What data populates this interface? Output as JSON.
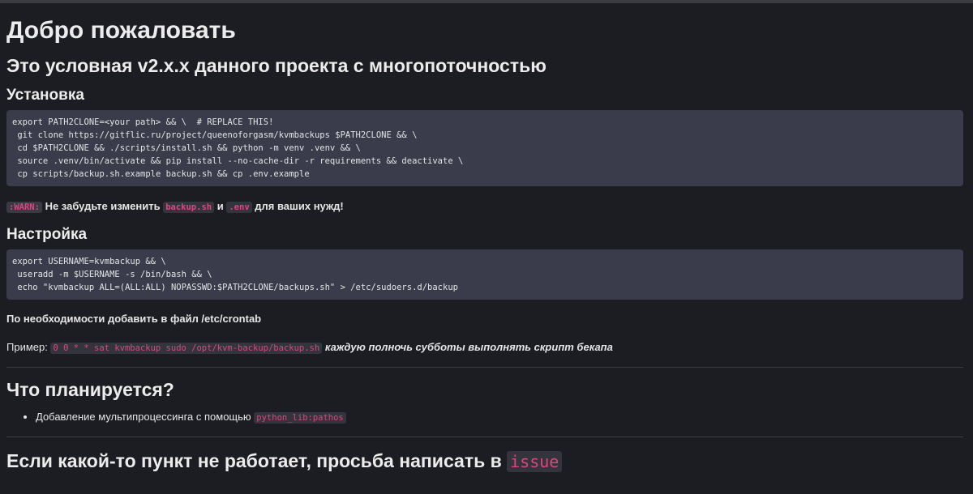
{
  "title": "Добро пожаловать",
  "subtitle": "Это условная v2.x.x данного проекта с многопоточностью",
  "install": {
    "heading": "Установка",
    "code": "export PATH2CLONE=<your path> && \\  # REPLACE THIS!\n git clone https://gitflic.ru/project/queenoforgasm/kvmbackups $PATH2CLONE && \\\n cd $PATH2CLONE && ./scripts/install.sh && python -m venv .venv && \\\n source .venv/bin/activate && pip install --no-cache-dir -r requirements && deactivate \\\n cp scripts/backup.sh.example backup.sh && cp .env.example"
  },
  "warning": {
    "tag": ":WARN:",
    "text_before": "Не забудьте изменить",
    "file1": "backup.sh",
    "conj": "и",
    "file2": ".env",
    "text_after": "для ваших нужд!"
  },
  "setup": {
    "heading": "Настройка",
    "code": "export USERNAME=kvmbackup && \\\n useradd -m $USERNAME -s /bin/bash && \\\n echo \"kvmbackup ALL=(ALL:ALL) NOPASSWD:$PATH2CLONE/backups.sh\" > /etc/sudoers.d/backup",
    "crontab_note": "По необходимости добавить в файл /etc/crontab",
    "example_label": "Пример:",
    "example_code": "0 0 * * sat kvmbackup sudo /opt/kvm-backup/backup.sh",
    "example_desc": "каждую полночь субботы выполнять скрипт бекапа"
  },
  "planned": {
    "heading": "Что планируется?",
    "items": [
      {
        "text": "Добавление мультипроцессинга с помощью",
        "code": "python_lib:pathos"
      }
    ]
  },
  "footer": {
    "text": "Если какой-то пункт не работает, просьба написать в",
    "code": "issue"
  },
  "colors": {
    "background": "#1c1d22",
    "code_block_bg": "#3a3c4c",
    "inline_code_fg": "#e0447c"
  }
}
